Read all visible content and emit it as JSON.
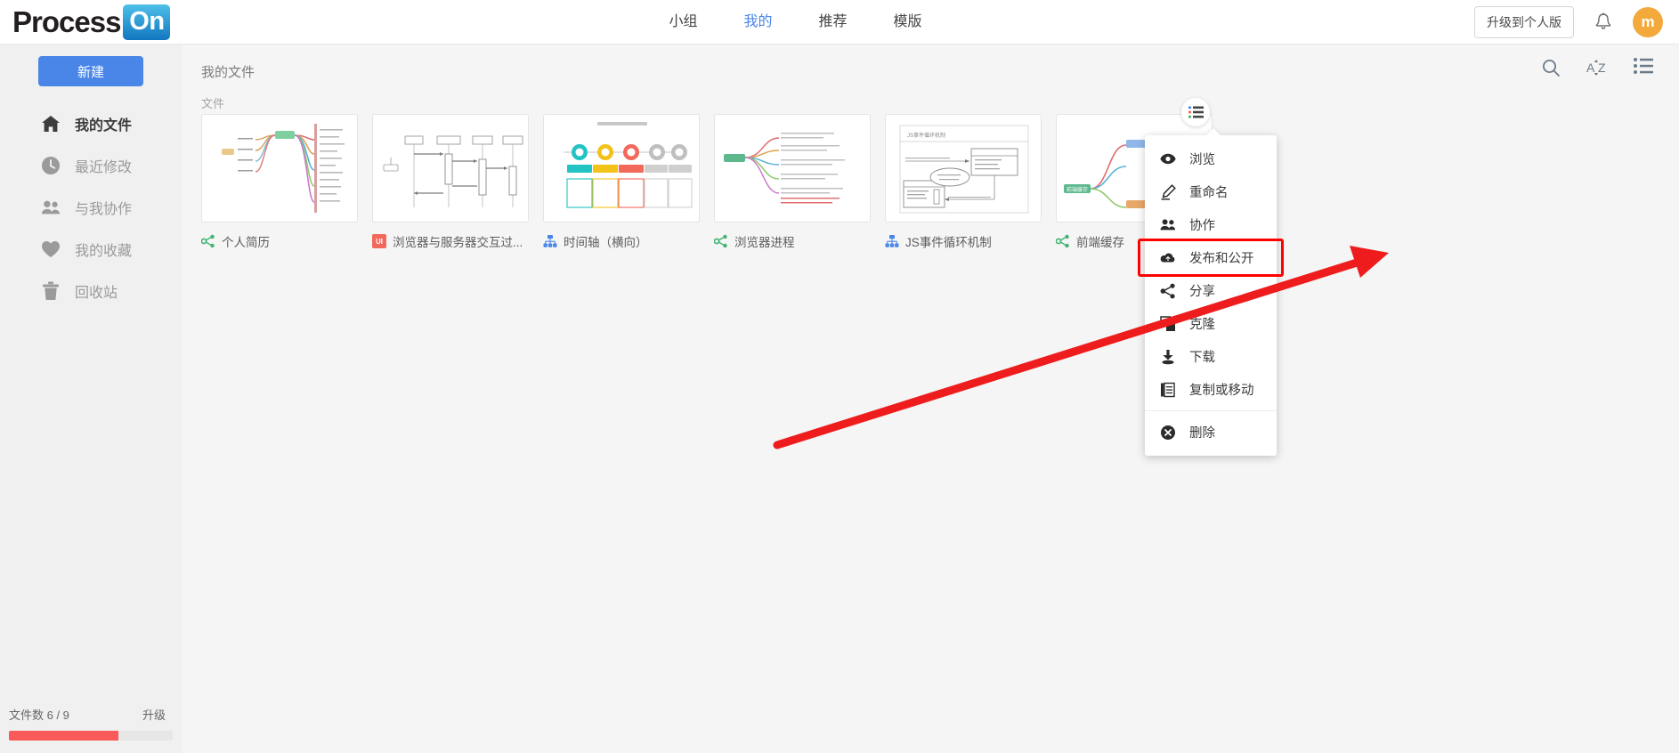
{
  "brand": {
    "name_dark": "Process",
    "name_light": "On",
    "accent": "#1277c1"
  },
  "topnav": {
    "items": [
      {
        "label": "小组",
        "active": false
      },
      {
        "label": "我的",
        "active": true
      },
      {
        "label": "推荐",
        "active": false
      },
      {
        "label": "模版",
        "active": false
      }
    ],
    "upgrade_label": "升级到个人版",
    "avatar_initial": "m",
    "accent": "#4a86e8"
  },
  "sidebar": {
    "new_button": "新建",
    "items": [
      {
        "label": "我的文件",
        "icon": "home-icon",
        "active": true
      },
      {
        "label": "最近修改",
        "icon": "clock-icon",
        "active": false
      },
      {
        "label": "与我协作",
        "icon": "people-icon",
        "active": false
      },
      {
        "label": "我的收藏",
        "icon": "heart-icon",
        "active": false
      },
      {
        "label": "回收站",
        "icon": "trash-icon",
        "active": false
      }
    ]
  },
  "footer": {
    "count_label": "文件数 6 / 9",
    "upgrade_label": "升级",
    "progress_percent": 67,
    "progress_color": "#fa5a5a"
  },
  "main": {
    "breadcrumb": "我的文件",
    "section_label": "文件",
    "toolbar": [
      {
        "name": "search-icon",
        "label": "搜索"
      },
      {
        "name": "sort-az-icon",
        "label": "AZ"
      },
      {
        "name": "list-view-icon",
        "label": "列表视图"
      }
    ]
  },
  "files": [
    {
      "name": "个人简历",
      "type_icon": "mindmap-icon",
      "icon_color": "#3eb370",
      "thumb": "mindmap"
    },
    {
      "name": "浏览器与服务器交互过...",
      "type_icon": "ui-badge",
      "icon_color": "#f2695c",
      "thumb": "sequence"
    },
    {
      "name": "时间轴（横向）",
      "type_icon": "flowchart-icon",
      "icon_color": "#4a86e8",
      "thumb": "timeline"
    },
    {
      "name": "浏览器进程",
      "type_icon": "mindmap-icon",
      "icon_color": "#3eb370",
      "thumb": "mindmap2"
    },
    {
      "name": "JS事件循环机制",
      "type_icon": "flowchart-icon",
      "icon_color": "#4a86e8",
      "thumb": "flowchart"
    },
    {
      "name": "前端缓存",
      "type_icon": "mindmap-icon",
      "icon_color": "#3eb370",
      "thumb": "mindmap3"
    }
  ],
  "context_menu": {
    "items": [
      {
        "label": "浏览",
        "icon": "eye-icon",
        "highlighted": false
      },
      {
        "label": "重命名",
        "icon": "pencil-icon",
        "highlighted": false
      },
      {
        "label": "协作",
        "icon": "people-icon",
        "highlighted": false
      },
      {
        "label": "发布和公开",
        "icon": "cloud-upload-icon",
        "highlighted": true
      },
      {
        "label": "分享",
        "icon": "share-icon",
        "highlighted": false
      },
      {
        "label": "克隆",
        "icon": "clone-icon",
        "highlighted": false
      },
      {
        "label": "下载",
        "icon": "download-icon",
        "highlighted": false
      },
      {
        "label": "复制或移动",
        "icon": "copy-move-icon",
        "highlighted": false
      },
      {
        "label": "删除",
        "icon": "delete-circle-icon",
        "highlighted": false
      }
    ],
    "divider_after_index": 7,
    "highlight_color": "#ff0000"
  },
  "annotation": {
    "arrow_color": "#ee1c1c"
  }
}
